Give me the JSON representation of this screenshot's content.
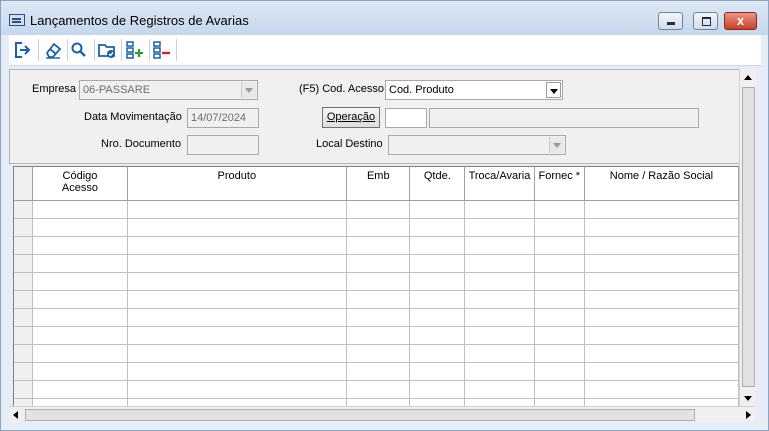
{
  "window": {
    "title": "Lançamentos de Registros de Avarias",
    "close_glyph": "x"
  },
  "toolbar": {
    "buttons": [
      {
        "name": "exit-icon"
      },
      {
        "name": "eraser-icon"
      },
      {
        "name": "search-icon"
      },
      {
        "name": "folder-check-icon"
      },
      {
        "name": "add-row-icon"
      },
      {
        "name": "remove-row-icon"
      }
    ],
    "colors": {
      "icon": "#1d5fa8",
      "add": "#2f9a2f",
      "remove": "#d02424"
    }
  },
  "form": {
    "empresa": {
      "label": "Empresa",
      "value": "06-PASSARE"
    },
    "data_movimentacao": {
      "label": "Data Movimentação",
      "value": "14/07/2024"
    },
    "nro_documento": {
      "label": "Nro. Documento",
      "value": ""
    },
    "cod_acesso": {
      "label": "(F5) Cod. Acesso",
      "value": "Cod. Produto"
    },
    "operacao": {
      "button_label": "Operação",
      "code": "",
      "description": ""
    },
    "local_destino": {
      "label": "Local Destino",
      "value": ""
    }
  },
  "grid": {
    "columns": [
      "Código\nAcesso",
      "Produto",
      "Emb",
      "Qtde.",
      "Troca/Avaria",
      "Fornec *",
      "Nome / Razão Social"
    ],
    "row_count": 12
  }
}
